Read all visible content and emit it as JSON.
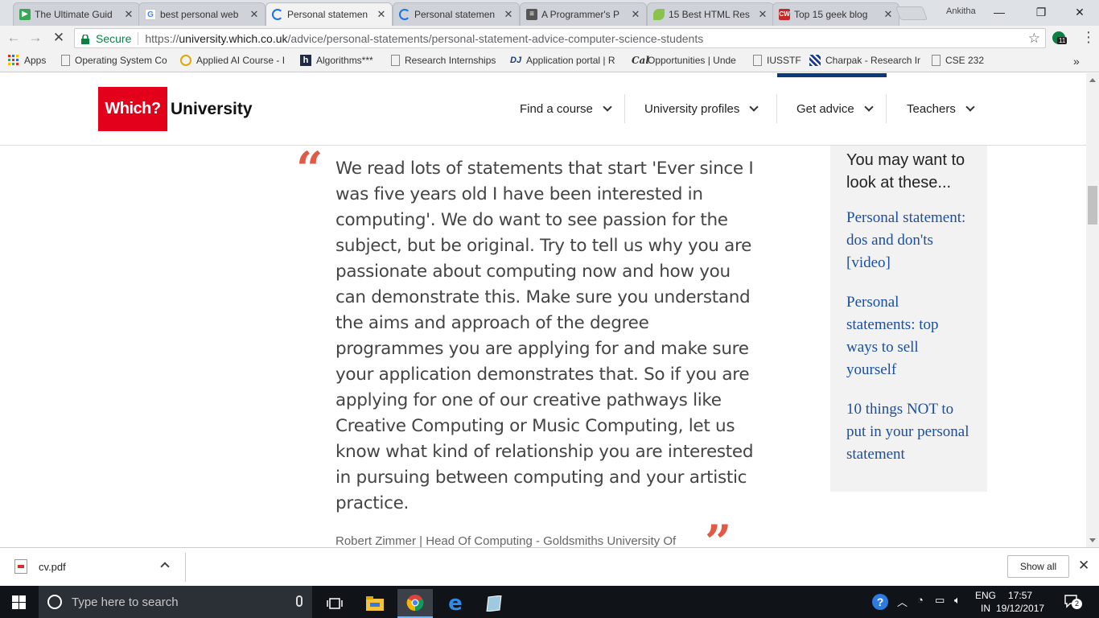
{
  "browser": {
    "tabs": [
      {
        "label": "The Ultimate Guid",
        "icon": "green-play-icon",
        "color": "#3aa757"
      },
      {
        "label": "best personal web",
        "icon": "google-icon",
        "color": "#4285f4"
      },
      {
        "label": "Personal statemen",
        "icon": "loading-icon",
        "color": "#1a73e8",
        "active": true
      },
      {
        "label": "Personal statemen",
        "icon": "loading-icon",
        "color": "#1a73e8"
      },
      {
        "label": "A Programmer's P",
        "icon": "document-icon",
        "color": "#555555"
      },
      {
        "label": "15 Best HTML Res",
        "icon": "leaf-icon",
        "color": "#8bc34a"
      },
      {
        "label": "Top 15 geek blog",
        "icon": "cw-icon",
        "color": "#c62828"
      }
    ],
    "user": "Ankitha",
    "address": {
      "secure_label": "Secure",
      "url_prefix": "https://",
      "url_domain": "university.which.co.uk",
      "url_path": "/advice/personal-statements/personal-statement-advice-computer-science-students"
    },
    "extension_badge": "11",
    "bookmarks": [
      {
        "label": "Apps",
        "icon": "apps-grid-icon"
      },
      {
        "label": "Operating System Co",
        "icon": "page-icon"
      },
      {
        "label": "Applied AI Course - I",
        "icon": "circle-logo-icon"
      },
      {
        "label": "Algorithms***",
        "icon": "h-logo-icon"
      },
      {
        "label": "Research Internships",
        "icon": "page-icon"
      },
      {
        "label": "Application portal | R",
        "icon": "dj-logo-icon"
      },
      {
        "label": "Opportunities | Unde",
        "icon": "cal-logo-icon"
      },
      {
        "label": "IUSSTF",
        "icon": "page-icon"
      },
      {
        "label": "Charpak - Research Ir",
        "icon": "flag-icon"
      },
      {
        "label": "CSE 232",
        "icon": "page-icon"
      }
    ]
  },
  "site": {
    "logo_which": "Which?",
    "logo_university": "University",
    "nav": [
      "Find a course",
      "University profiles",
      "Get advice",
      "Teachers"
    ],
    "quote_mark_open": "“",
    "quote_mark_close": "”",
    "quote": "We read lots of statements that start 'Ever since I was five years old I have been interested in computing'. We do want to see passion for the subject, but be original. Try to tell us why you are passionate about computing now and how you can demonstrate this. Make sure you understand the aims and approach of the degree programmes you are applying for and make sure your application demonstrates that. So if you are applying for one of our creative pathways like Creative Computing or Music Computing, let us know what kind of relationship you are interested in pursuing between computing and your artistic practice.",
    "attribution": "Robert Zimmer | Head Of Computing - Goldsmiths University Of",
    "aside": {
      "title": "You may want to look at these...",
      "links": [
        "Personal statement: dos and don'ts [video]",
        "Personal statements: top ways to sell yourself",
        "10 things NOT to put in your personal statement"
      ]
    }
  },
  "downloads": {
    "file": "cv.pdf",
    "show_all": "Show all"
  },
  "taskbar": {
    "search_placeholder": "Type here to search",
    "lang_1": "ENG",
    "lang_2": "IN",
    "time": "17:57",
    "date": "19/12/2017",
    "notifications": "2"
  },
  "colors": {
    "brand_red": "#e2001a",
    "quote_mark": "#e05a45",
    "link_blue": "#1a4fa0",
    "nav_active": "#0a3a7a"
  }
}
